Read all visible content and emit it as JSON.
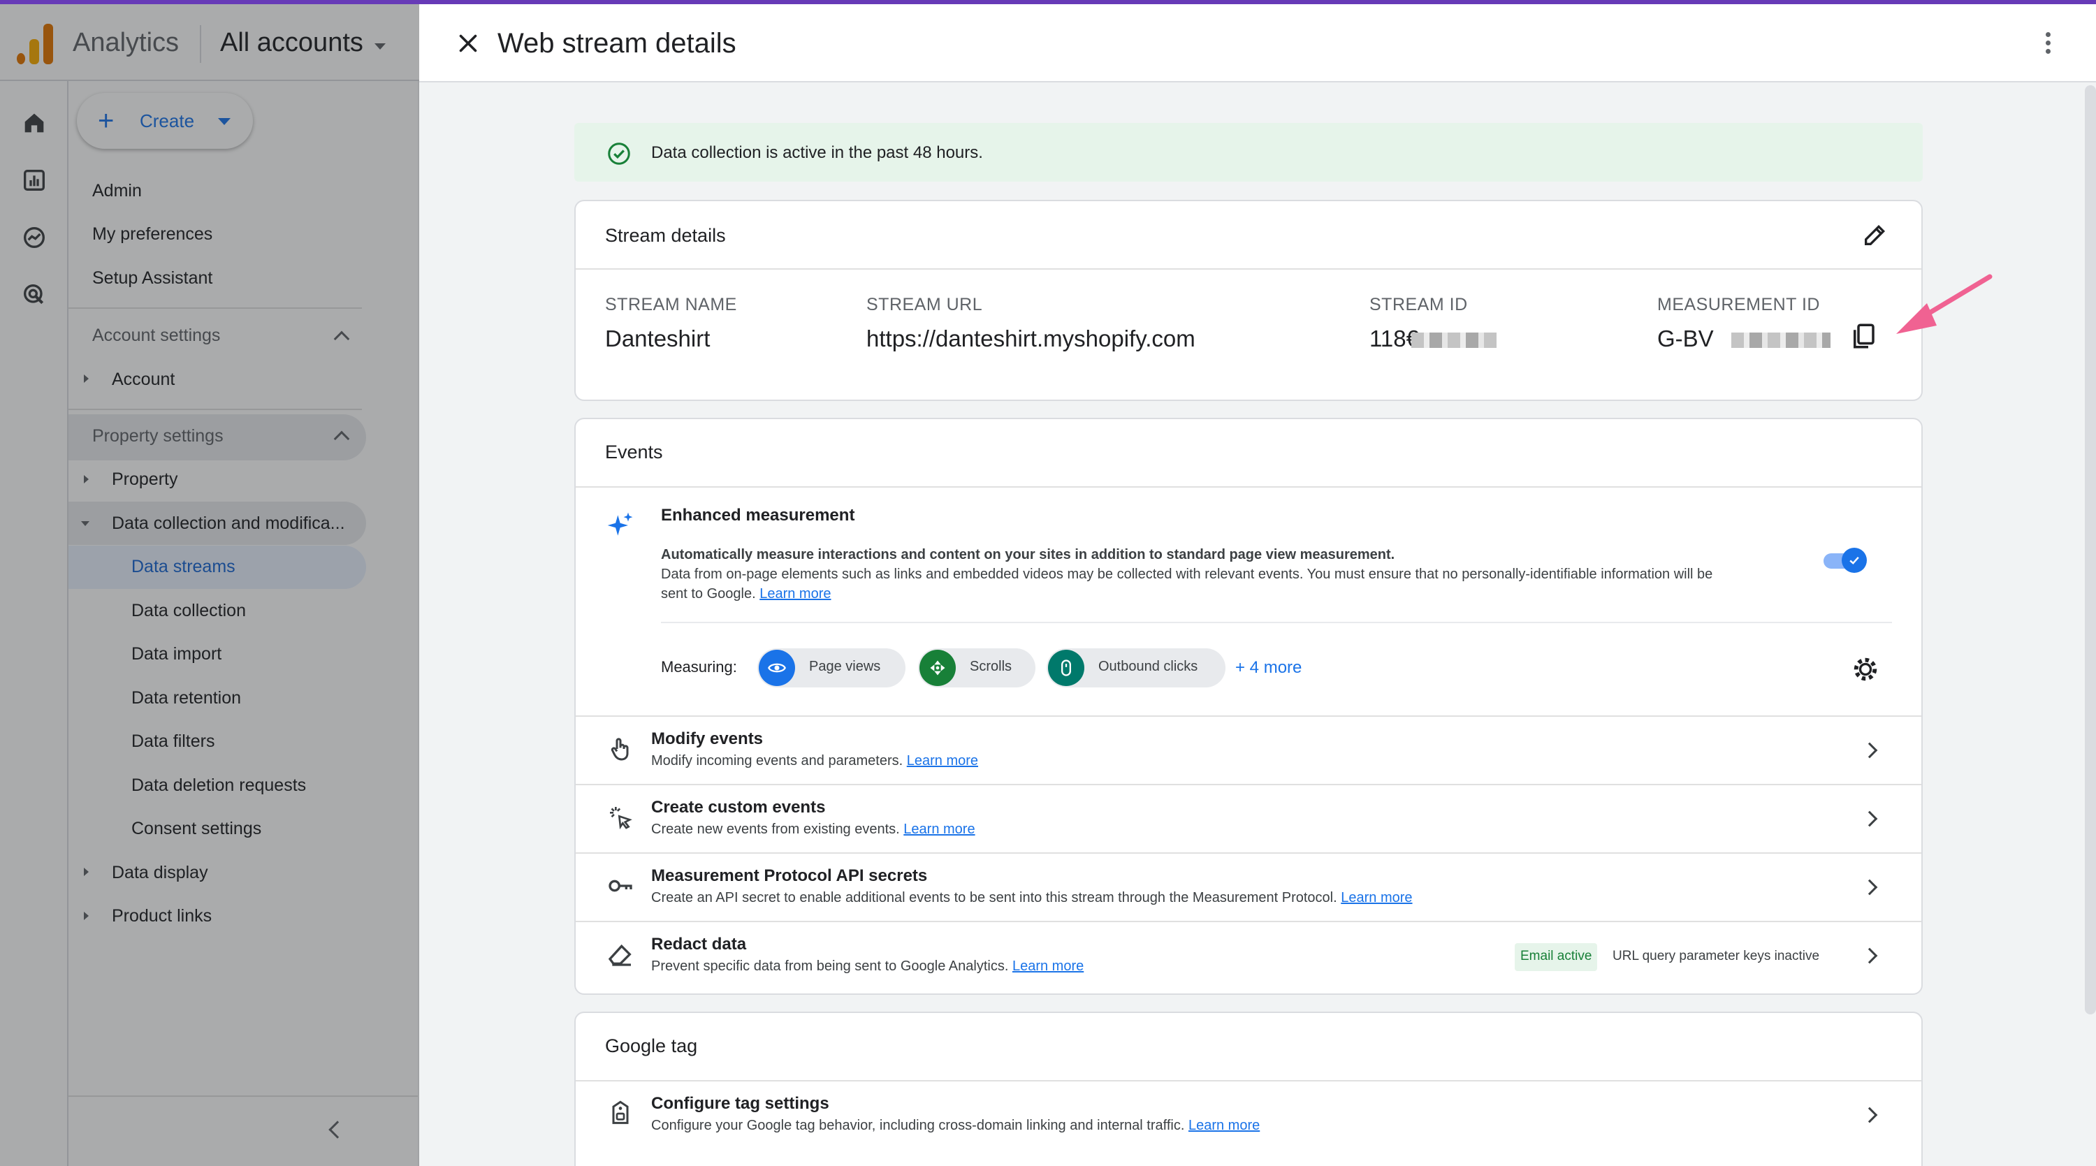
{
  "header": {
    "app_name": "Analytics",
    "account_selector": "All accounts"
  },
  "nav": {
    "create_label": "Create",
    "admin": "Admin",
    "my_preferences": "My preferences",
    "setup_assistant": "Setup Assistant",
    "account_settings": "Account settings",
    "account": "Account",
    "property_settings": "Property settings",
    "property": "Property",
    "data_collection_group": "Data collection and modifica...",
    "data_streams": "Data streams",
    "data_collection": "Data collection",
    "data_import": "Data import",
    "data_retention": "Data retention",
    "data_filters": "Data filters",
    "data_deletion_requests": "Data deletion requests",
    "consent_settings": "Consent settings",
    "data_display": "Data display",
    "product_links": "Product links"
  },
  "panel": {
    "title": "Web stream details",
    "banner": "Data collection is active in the past 48 hours.",
    "stream_details": {
      "title": "Stream details",
      "stream_name_label": "STREAM NAME",
      "stream_name": "Danteshirt",
      "stream_url_label": "STREAM URL",
      "stream_url": "https://danteshirt.myshopify.com",
      "stream_id_label": "STREAM ID",
      "stream_id": "118€",
      "measurement_id_label": "MEASUREMENT ID",
      "measurement_id": "G-BV"
    },
    "events": {
      "title": "Events",
      "enhanced_title": "Enhanced measurement",
      "enhanced_desc_bold": "Automatically measure interactions and content on your sites in addition to standard page view measurement.",
      "enhanced_desc_line2": "Data from on-page elements such as links and embedded videos may be collected with relevant events. You must ensure that no personally-identifiable information will be",
      "enhanced_desc_line3": "sent to Google.",
      "learn_more": "Learn more",
      "enhanced_enabled": true,
      "measuring_label": "Measuring:",
      "chips": [
        "Page views",
        "Scrolls",
        "Outbound clicks"
      ],
      "more_label": "+ 4 more",
      "rows": [
        {
          "title": "Modify events",
          "desc": "Modify incoming events and parameters.",
          "link": "Learn more"
        },
        {
          "title": "Create custom events",
          "desc": "Create new events from existing events.",
          "link": "Learn more"
        },
        {
          "title": "Measurement Protocol API secrets",
          "desc": "Create an API secret to enable additional events to be sent into this stream through the Measurement Protocol.",
          "link": "Learn more"
        },
        {
          "title": "Redact data",
          "desc": "Prevent specific data from being sent to Google Analytics.",
          "link": "Learn more",
          "badge_active": "Email active",
          "badge_inactive": "URL query parameter keys inactive"
        }
      ]
    },
    "google_tag": {
      "title": "Google tag",
      "row_title": "Configure tag settings",
      "row_desc": "Configure your Google tag behavior, including cross-domain linking and internal traffic.",
      "row_link": "Learn more"
    }
  },
  "colors": {
    "accent": "#1a73e8",
    "banner_bg": "#e6f4ea",
    "active_green": "#188038",
    "annotation_arrow": "#f06292",
    "top_bar": "#673ab7"
  }
}
